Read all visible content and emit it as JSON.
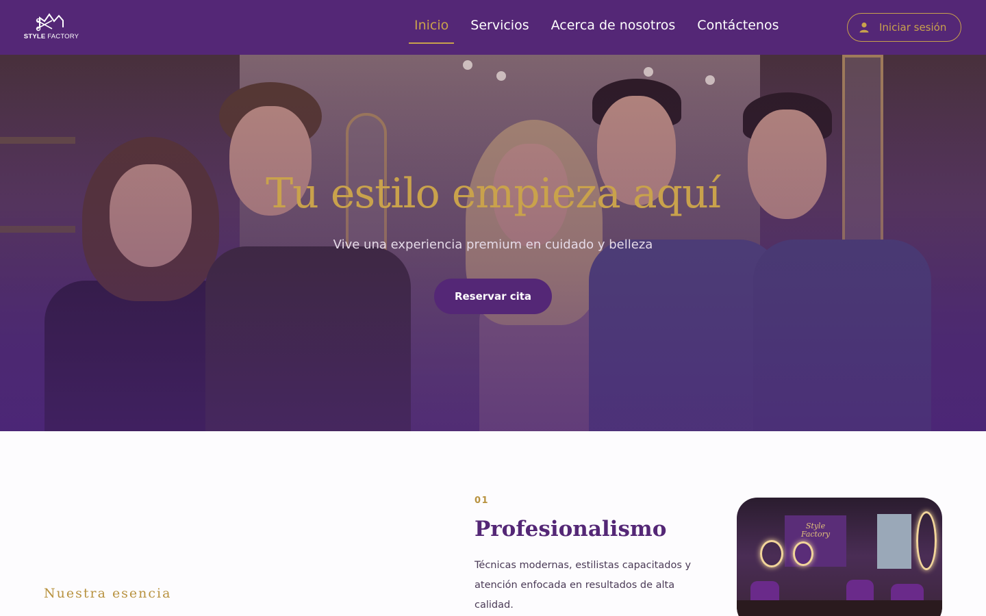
{
  "brand": {
    "logo_text_bold": "STYLE",
    "logo_text_rest": " FACTORY"
  },
  "nav": {
    "links": [
      {
        "label": "Inicio",
        "active": true
      },
      {
        "label": "Servicios",
        "active": false
      },
      {
        "label": "Acerca de nosotros",
        "active": false
      },
      {
        "label": "Contáctenos",
        "active": false
      }
    ],
    "login_label": "Iniciar sesión"
  },
  "hero": {
    "title": "Tu estilo empieza aquí",
    "subtitle": "Vive una experiencia premium en cuidado y belleza",
    "cta_label": "Reservar cita"
  },
  "essence": {
    "section_label": "Nuestra esencia",
    "feature": {
      "number": "01",
      "title": "Profesionalismo",
      "description": "Técnicas modernas, estilistas capacitados y atención enfocada en resultados de alta calidad.",
      "image_sign_line1": "Style",
      "image_sign_line2": "Factory"
    }
  },
  "colors": {
    "brand_purple": "#542776",
    "accent_gold": "#c9a24c",
    "text_dark": "#3a2a4a"
  },
  "icons": {
    "logo": "crown-scissors-logo-icon",
    "login": "user-icon"
  }
}
